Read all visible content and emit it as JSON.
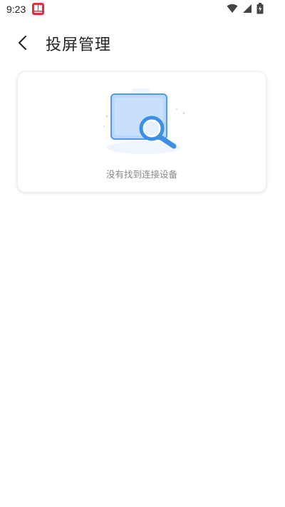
{
  "status_bar": {
    "time": "9:23",
    "app_notification_icon": "book-app-icon",
    "icons": [
      "wifi-icon",
      "signal-icon",
      "battery-icon"
    ]
  },
  "header": {
    "title": "投屏管理",
    "back_icon": "chevron-left-icon"
  },
  "device_card": {
    "empty_message": "没有找到连接设备",
    "illustration": "search-device-illustration"
  },
  "colors": {
    "accent_blue": "#5aa6f2",
    "screen_fill": "#b9d8fb",
    "text_primary": "#222222",
    "text_secondary": "#888888"
  }
}
